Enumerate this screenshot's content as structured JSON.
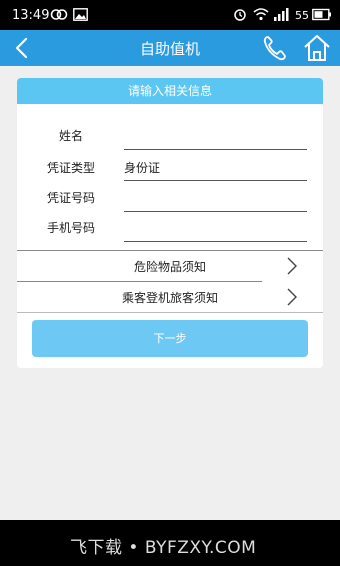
{
  "status_bar": {
    "time": "13:49",
    "battery": "55"
  },
  "appbar": {
    "title": "自助值机"
  },
  "card": {
    "header": "请输入相关信息",
    "fields": [
      {
        "label": "姓名",
        "value": ""
      },
      {
        "label": "凭证类型",
        "value": "身份证"
      },
      {
        "label": "凭证号码",
        "value": ""
      },
      {
        "label": "手机号码",
        "value": ""
      }
    ],
    "links": [
      {
        "label": "危险物品须知"
      },
      {
        "label": "乘客登机旅客须知"
      }
    ],
    "next_button": "下一步"
  },
  "watermark": "飞下载 • BYFZXY.COM",
  "colors": {
    "appbar": "#2b9be0",
    "card_header": "#5cc6f2",
    "button": "#6ec8f4",
    "background": "#efefef"
  }
}
